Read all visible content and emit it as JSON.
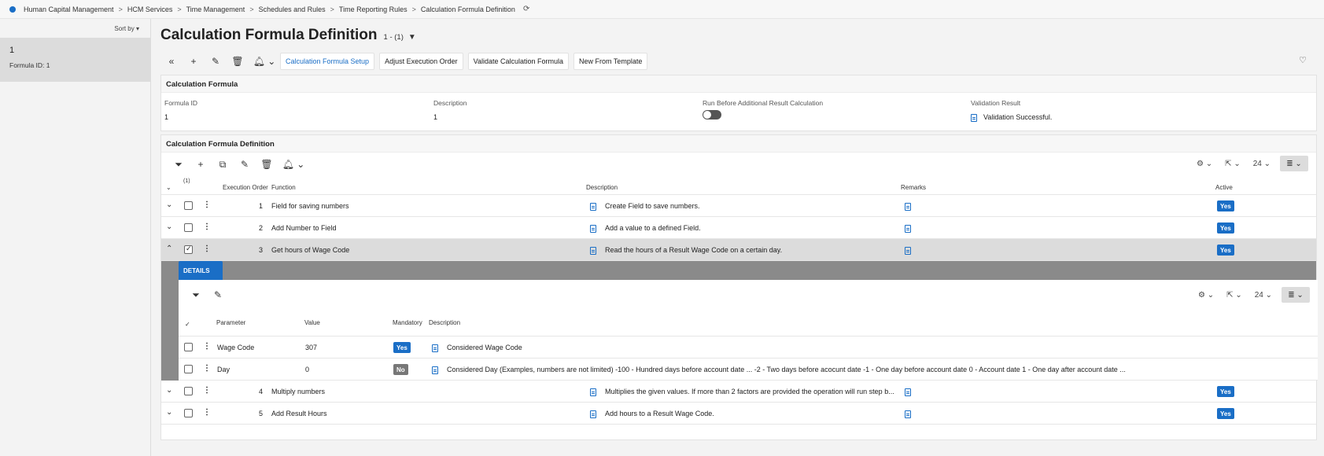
{
  "breadcrumb": [
    "Human Capital Management",
    "HCM Services",
    "Time Management",
    "Schedules and Rules",
    "Time Reporting Rules",
    "Calculation Formula Definition"
  ],
  "left_panel": {
    "sort_label": "Sort by",
    "record_title": "1",
    "record_sub": "Formula ID:  1"
  },
  "page": {
    "title": "Calculation Formula Definition",
    "count": "1 - (1)"
  },
  "toolbar": {
    "buttons": [
      "Calculation Formula Setup",
      "Adjust Execution Order",
      "Validate Calculation Formula",
      "New From Template"
    ]
  },
  "calc_formula": {
    "header": "Calculation Formula",
    "formula_id_label": "Formula ID",
    "formula_id_value": "1",
    "description_label": "Description",
    "description_value": "1",
    "run_before_label": "Run Before Additional Result Calculation",
    "validation_label": "Validation Result",
    "validation_value": "Validation Successful."
  },
  "definition": {
    "header": "Calculation Formula Definition",
    "page_size": "24",
    "selected_count": "(1)",
    "columns": {
      "execution_order": "Execution Order",
      "function": "Function",
      "description": "Description",
      "remarks": "Remarks",
      "active": "Active"
    },
    "rows": [
      {
        "order": "1",
        "function": "Field for saving numbers",
        "description": "Create Field to save numbers.",
        "active": "Yes"
      },
      {
        "order": "2",
        "function": "Add Number to Field",
        "description": "Add a value to a defined Field.",
        "active": "Yes"
      },
      {
        "order": "3",
        "function": "Get hours of Wage Code",
        "description": "Read the hours of a Result Wage Code on a certain day.",
        "active": "Yes"
      },
      {
        "order": "4",
        "function": "Multiply numbers",
        "description": "Multiplies the given values. If more than 2 factors are provided the operation will run step b...",
        "active": "Yes"
      },
      {
        "order": "5",
        "function": "Add Result Hours",
        "description": "Add hours to a Result Wage Code.",
        "active": "Yes"
      }
    ]
  },
  "details": {
    "tab_label": "DETAILS",
    "page_size": "24",
    "columns": {
      "parameter": "Parameter",
      "value": "Value",
      "mandatory": "Mandatory",
      "description": "Description"
    },
    "rows": [
      {
        "parameter": "Wage Code",
        "value": "307",
        "mandatory": "Yes",
        "description": "Considered Wage Code"
      },
      {
        "parameter": "Day",
        "value": "0",
        "mandatory": "No",
        "description": "Considered Day (Examples, numbers are not limited) -100 - Hundred days before account date ... -2 - Two days before acocunt date -1 - One day before account date 0 - Account date 1 - One day after account date ..."
      }
    ]
  }
}
